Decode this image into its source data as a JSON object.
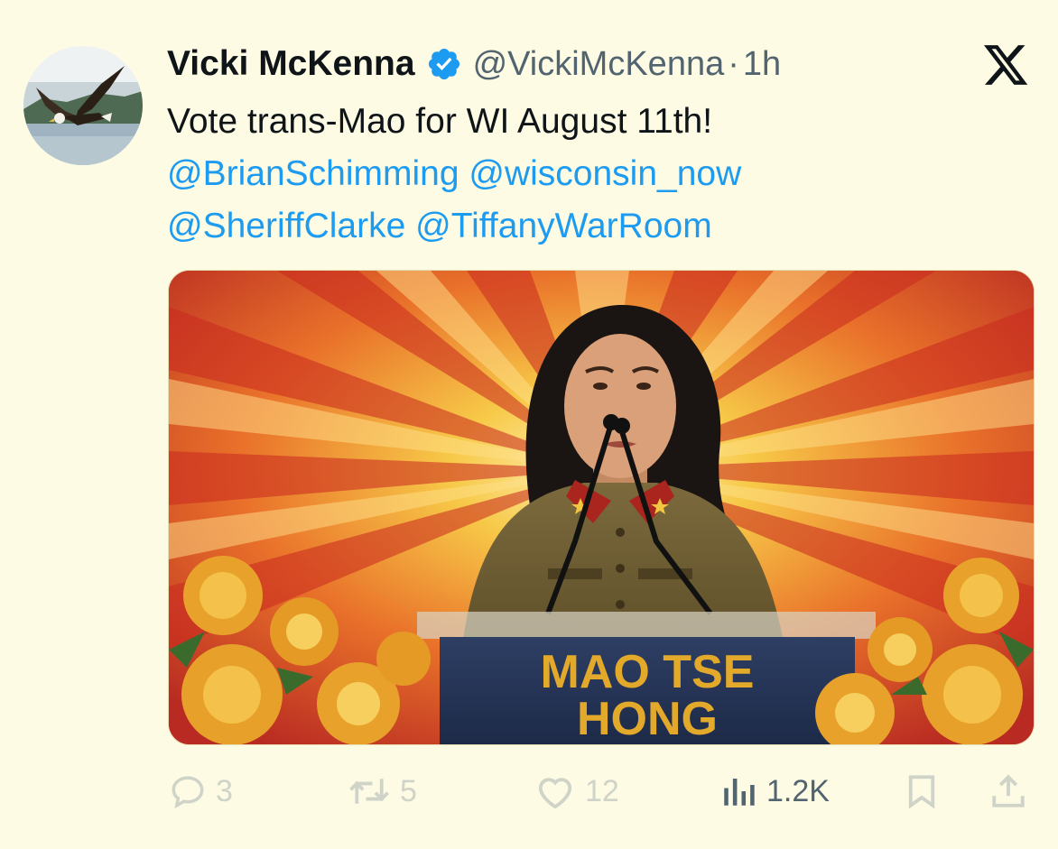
{
  "tweet": {
    "display_name": "Vicki McKenna",
    "handle": "@VickiMcKenna",
    "separator": "·",
    "time": "1h",
    "text_line1": "Vote trans-Mao for WI August 11th!",
    "mentions_line2": [
      "@BrianSchimming",
      "@wisconsin_now"
    ],
    "mentions_line3": [
      "@SheriffClarke",
      "@TiffanyWarRoom"
    ]
  },
  "media": {
    "podium_line1": "MAO TSE",
    "podium_line2": "HONG"
  },
  "actions": {
    "replies": "3",
    "reposts": "5",
    "likes": "12",
    "views": "1.2K"
  },
  "colors": {
    "background": "#fdfbe3",
    "mention": "#1d9bf0",
    "verified": "#1d9bf0",
    "muted": "#536471"
  },
  "icons": {
    "avatar": "eagle-avatar",
    "verified": "verified-badge-icon",
    "brand": "x-logo-icon",
    "reply": "reply-icon",
    "repost": "repost-icon",
    "like": "heart-icon",
    "views": "views-icon",
    "bookmark": "bookmark-icon",
    "share": "share-icon"
  }
}
